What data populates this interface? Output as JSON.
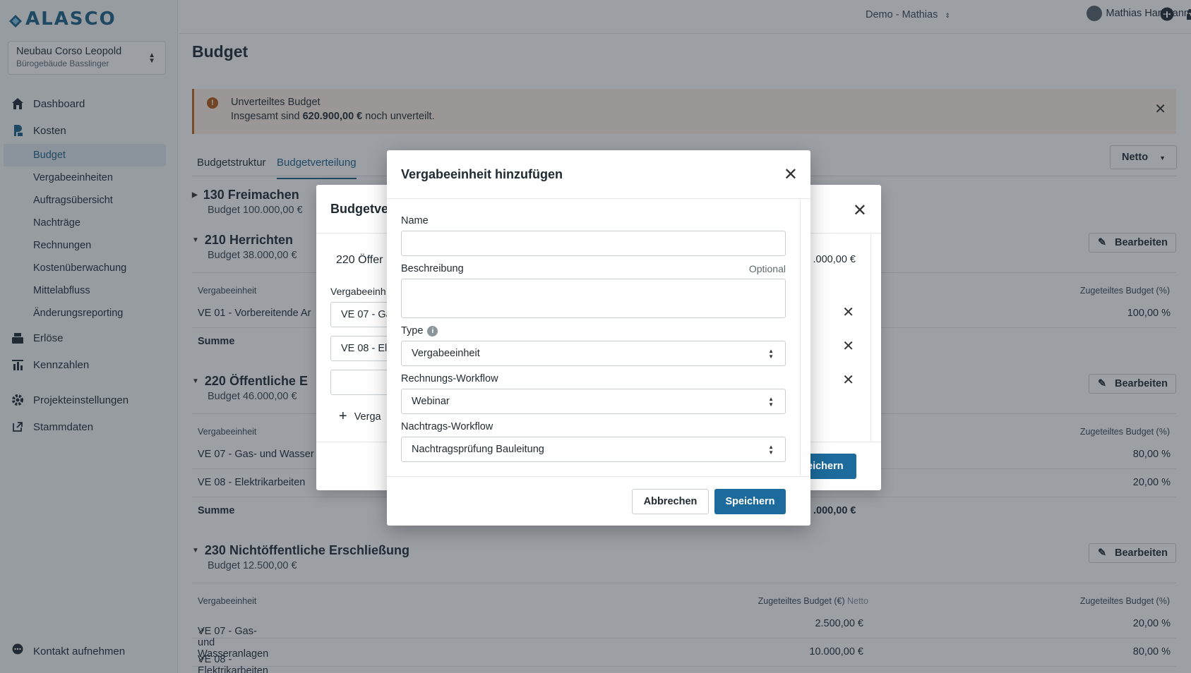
{
  "app": {
    "logo_text": "ALASCO"
  },
  "project": {
    "name": "Neubau Corso Leopold",
    "building": "Bürogebäude Basslinger"
  },
  "sidebar": {
    "items": [
      {
        "label": "Dashboard"
      },
      {
        "label": "Kosten"
      },
      {
        "label": "Erlöse"
      },
      {
        "label": "Kennzahlen"
      },
      {
        "label": "Projekteinstellungen"
      },
      {
        "label": "Stammdaten"
      }
    ],
    "kosten_sub": [
      {
        "label": "Budget"
      },
      {
        "label": "Vergabeeinheiten"
      },
      {
        "label": "Auftragsübersicht"
      },
      {
        "label": "Nachträge"
      },
      {
        "label": "Rechnungen"
      },
      {
        "label": "Kostenüberwachung"
      },
      {
        "label": "Mittelabfluss"
      },
      {
        "label": "Änderungsreporting"
      }
    ],
    "contact": "Kontakt aufnehmen"
  },
  "topbar": {
    "workspace": "Demo - Mathias",
    "inbox_badge": "24",
    "user_name": "Mathias Hartmann"
  },
  "page": {
    "title": "Budget",
    "alert": {
      "title": "Unverteiltes Budget",
      "text_pre": "Insgesamt sind ",
      "amount": "620.900,00 €",
      "text_post": " noch unverteilt."
    },
    "tabs": [
      {
        "label": "Budgetstruktur"
      },
      {
        "label": "Budgetverteilung"
      }
    ],
    "netto_button": "Netto",
    "edit_label": "Bearbeiten",
    "col_ve": "Vergabeeinheit",
    "col_budget_eur": "Zugeteiltes Budget (€)",
    "col_budget_eur_suffix": "Netto",
    "col_budget_pct": "Zugeteiltes Budget (%)",
    "sum_label": "Summe",
    "sections": [
      {
        "title": "130 Freimachen",
        "budget": "Budget 100.000,00 €"
      },
      {
        "title": "210 Herrichten",
        "budget": "Budget 38.000,00 €",
        "rows": [
          {
            "name": "VE 01 - Vorbereitende Ar",
            "pct": "100,00 %"
          }
        ]
      },
      {
        "title": "220 Öffentliche E",
        "budget": "Budget 46.000,00 €",
        "rows": [
          {
            "name": "VE 07 - Gas- und Wasser",
            "pct": "80,00 %"
          },
          {
            "name": "VE 08 - Elektrikarbeiten",
            "pct": "20,00 %"
          }
        ],
        "sum_eur": ".000,00 €"
      },
      {
        "title": "230 Nichtöffentliche Erschließung",
        "budget": "Budget 12.500,00 €",
        "rows": [
          {
            "name": "VE 07 - Gas- und Wasseranlagen",
            "eur": "2.500,00 €",
            "pct": "20,00 %"
          },
          {
            "name": "VE 08 - Elektrikarbeiten",
            "eur": "10.000,00 €",
            "pct": "80,00 %"
          }
        ]
      }
    ]
  },
  "back_modal": {
    "title": "Budgetve",
    "line": "220 Öffer",
    "line_amount": ".000,00 €",
    "label": "Vergabeeinh",
    "inputs": [
      "VE 07 - Ga",
      "VE 08 - El",
      ""
    ],
    "add_label": "Verga",
    "save_label": "eichern"
  },
  "modal": {
    "title": "Vergabeeinheit hinzufügen",
    "name_label": "Name",
    "name_value": "",
    "desc_label": "Beschreibung",
    "desc_optional": "Optional",
    "type_label": "Type",
    "type_value": "Vergabeeinheit",
    "invoice_label": "Rechnungs-Workflow",
    "invoice_value": "Webinar",
    "change_label": "Nachtrags-Workflow",
    "change_value": "Nachtragsprüfung Bauleitung",
    "cancel_label": "Abbrechen",
    "save_label": "Speichern"
  }
}
